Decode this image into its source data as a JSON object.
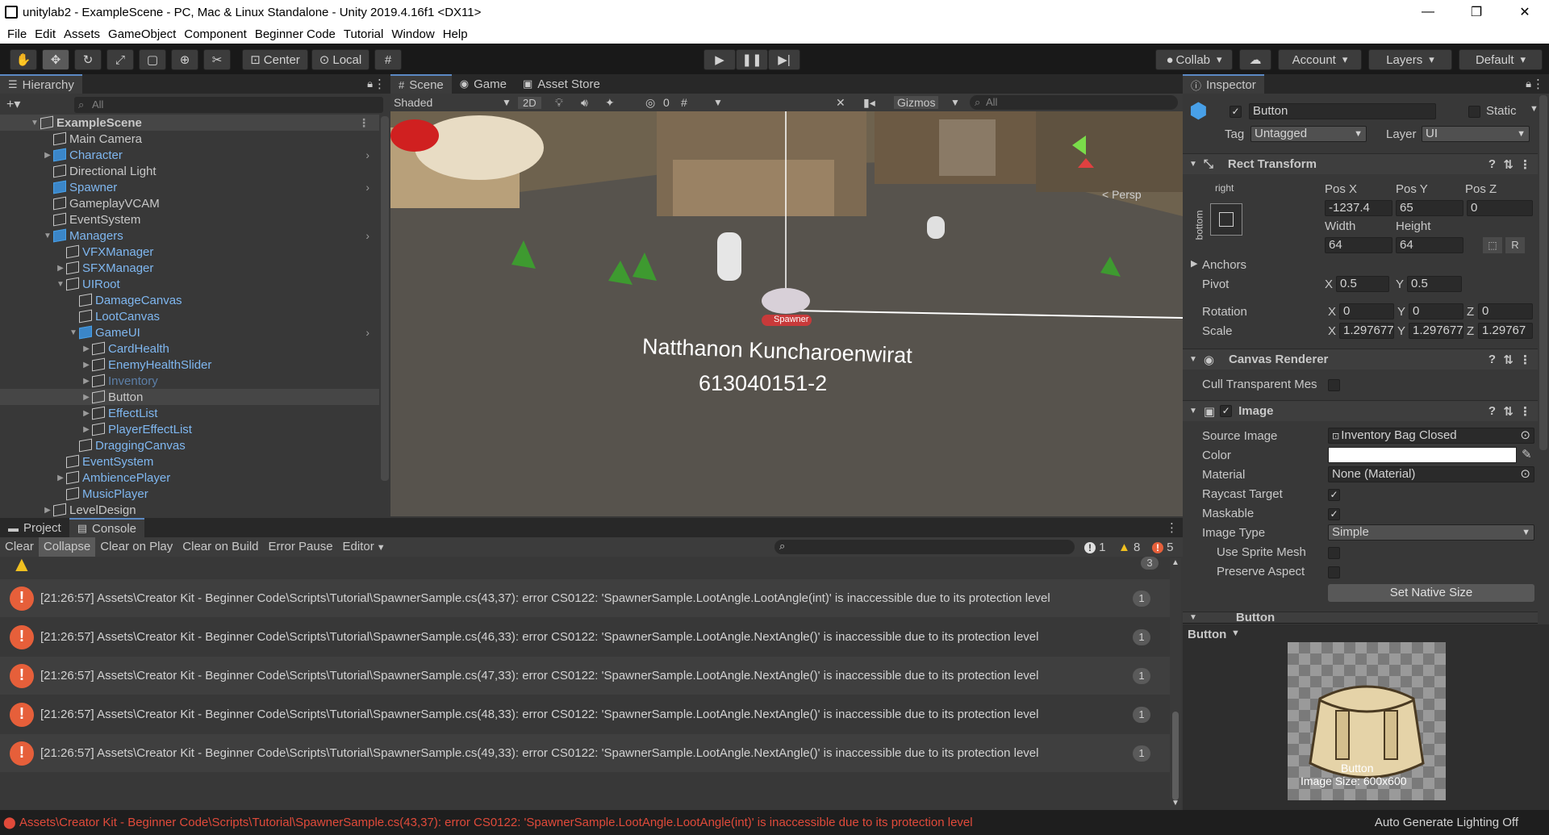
{
  "window": {
    "title": "unitylab2 - ExampleScene - PC, Mac & Linux Standalone - Unity 2019.4.16f1 <DX11>",
    "controls": [
      "—",
      "❐",
      "✕"
    ]
  },
  "menu": [
    "File",
    "Edit",
    "Assets",
    "GameObject",
    "Component",
    "Beginner Code",
    "Tutorial",
    "Window",
    "Help"
  ],
  "toolbar": {
    "pivot_label": "Center",
    "space_label": "Local",
    "collab_label": "Collab",
    "account_label": "Account",
    "layers_label": "Layers",
    "layout_label": "Default"
  },
  "hierarchy": {
    "tab_label": "Hierarchy",
    "search_placeholder": "All",
    "items": [
      {
        "label": "ExampleScene",
        "indent": 0,
        "arrow": "▼",
        "type": "scene"
      },
      {
        "label": "Main Camera",
        "indent": 1,
        "arrow": "",
        "type": "plain"
      },
      {
        "label": "Character",
        "indent": 1,
        "arrow": "▶",
        "type": "prefab",
        "more": true
      },
      {
        "label": "Directional Light",
        "indent": 1,
        "arrow": "",
        "type": "plain"
      },
      {
        "label": "Spawner",
        "indent": 1,
        "arrow": "",
        "type": "prefab",
        "more": true
      },
      {
        "label": "GameplayVCAM",
        "indent": 1,
        "arrow": "",
        "type": "plain"
      },
      {
        "label": "EventSystem",
        "indent": 1,
        "arrow": "",
        "type": "plain"
      },
      {
        "label": "Managers",
        "indent": 1,
        "arrow": "▼",
        "type": "prefab",
        "more": true
      },
      {
        "label": "VFXManager",
        "indent": 2,
        "arrow": "",
        "type": "prefab-child"
      },
      {
        "label": "SFXManager",
        "indent": 2,
        "arrow": "▶",
        "type": "prefab-child"
      },
      {
        "label": "UIRoot",
        "indent": 2,
        "arrow": "▼",
        "type": "prefab-child"
      },
      {
        "label": "DamageCanvas",
        "indent": 3,
        "arrow": "",
        "type": "prefab-child"
      },
      {
        "label": "LootCanvas",
        "indent": 3,
        "arrow": "",
        "type": "prefab-child"
      },
      {
        "label": "GameUI",
        "indent": 3,
        "arrow": "▼",
        "type": "prefab",
        "more": true
      },
      {
        "label": "CardHealth",
        "indent": 4,
        "arrow": "▶",
        "type": "prefab-child"
      },
      {
        "label": "EnemyHealthSlider",
        "indent": 4,
        "arrow": "▶",
        "type": "prefab-child"
      },
      {
        "label": "Inventory",
        "indent": 4,
        "arrow": "▶",
        "type": "dim"
      },
      {
        "label": "Button",
        "indent": 4,
        "arrow": "▶",
        "type": "selected"
      },
      {
        "label": "EffectList",
        "indent": 4,
        "arrow": "▶",
        "type": "prefab-child"
      },
      {
        "label": "PlayerEffectList",
        "indent": 4,
        "arrow": "▶",
        "type": "prefab-child"
      },
      {
        "label": "DraggingCanvas",
        "indent": 3,
        "arrow": "",
        "type": "prefab-child"
      },
      {
        "label": "EventSystem",
        "indent": 2,
        "arrow": "",
        "type": "prefab-child"
      },
      {
        "label": "AmbiencePlayer",
        "indent": 2,
        "arrow": "▶",
        "type": "prefab-child"
      },
      {
        "label": "MusicPlayer",
        "indent": 2,
        "arrow": "",
        "type": "prefab-child"
      },
      {
        "label": "LevelDesign",
        "indent": 1,
        "arrow": "▶",
        "type": "plain"
      }
    ]
  },
  "scene": {
    "tabs": [
      "Scene",
      "Game",
      "Asset Store"
    ],
    "shading_mode": "Shaded",
    "mode_2d": "2D",
    "hidden_count": "0",
    "gizmos_label": "Gizmos",
    "search_placeholder": "All",
    "perspective_label": "< Persp",
    "spawner_label": "Spawner",
    "overlay_name": "Natthanon Kuncharoenwirat",
    "overlay_id": "613040151-2"
  },
  "inspector": {
    "tab_label": "Inspector",
    "object_name": "Button",
    "static_label": "Static",
    "tag_label": "Tag",
    "tag_value": "Untagged",
    "layer_label": "Layer",
    "layer_value": "UI",
    "rect_transform": {
      "title": "Rect Transform",
      "anchor_h": "right",
      "anchor_v": "bottom",
      "pos_x_label": "Pos X",
      "pos_x": "-1237.4",
      "pos_y_label": "Pos Y",
      "pos_y": "65",
      "pos_z_label": "Pos Z",
      "pos_z": "0",
      "width_label": "Width",
      "width": "64",
      "height_label": "Height",
      "height": "64",
      "anchors_label": "Anchors",
      "pivot_label": "Pivot",
      "pivot_x": "0.5",
      "pivot_y": "0.5",
      "rotation_label": "Rotation",
      "rot_x": "0",
      "rot_y": "0",
      "rot_z": "0",
      "scale_label": "Scale",
      "scale_x": "1.297677",
      "scale_y": "1.297677",
      "scale_z": "1.29767",
      "r_button": "R"
    },
    "canvas_renderer": {
      "title": "Canvas Renderer",
      "cull_label": "Cull Transparent Mes"
    },
    "image": {
      "title": "Image",
      "source_image_label": "Source Image",
      "source_image_value": "Inventory Bag Closed",
      "color_label": "Color",
      "color_value": "#ffffff",
      "material_label": "Material",
      "material_value": "None (Material)",
      "raycast_label": "Raycast Target",
      "maskable_label": "Maskable",
      "image_type_label": "Image Type",
      "image_type_value": "Simple",
      "sprite_mesh_label": "Use Sprite Mesh",
      "preserve_label": "Preserve Aspect",
      "native_size_button": "Set Native Size"
    },
    "button_component": {
      "title": "Button"
    },
    "preview": {
      "dropdown": "Button",
      "caption_name": "Button",
      "caption_size": "Image Size: 600x600"
    }
  },
  "console": {
    "tabs": [
      "Project",
      "Console"
    ],
    "buttons": [
      "Clear",
      "Collapse",
      "Clear on Play",
      "Clear on Build",
      "Error Pause",
      "Editor"
    ],
    "info_count": "1",
    "warn_count": "8",
    "error_count": "5",
    "partial_count": "3",
    "logs": [
      {
        "text": "[21:26:57] Assets\\Creator Kit - Beginner Code\\Scripts\\Tutorial\\SpawnerSample.cs(43,37): error CS0122: 'SpawnerSample.LootAngle.LootAngle(int)' is inaccessible due to its protection level",
        "count": "1"
      },
      {
        "text": "[21:26:57] Assets\\Creator Kit - Beginner Code\\Scripts\\Tutorial\\SpawnerSample.cs(46,33): error CS0122: 'SpawnerSample.LootAngle.NextAngle()' is inaccessible due to its protection level",
        "count": "1"
      },
      {
        "text": "[21:26:57] Assets\\Creator Kit - Beginner Code\\Scripts\\Tutorial\\SpawnerSample.cs(47,33): error CS0122: 'SpawnerSample.LootAngle.NextAngle()' is inaccessible due to its protection level",
        "count": "1"
      },
      {
        "text": "[21:26:57] Assets\\Creator Kit - Beginner Code\\Scripts\\Tutorial\\SpawnerSample.cs(48,33): error CS0122: 'SpawnerSample.LootAngle.NextAngle()' is inaccessible due to its protection level",
        "count": "1"
      },
      {
        "text": "[21:26:57] Assets\\Creator Kit - Beginner Code\\Scripts\\Tutorial\\SpawnerSample.cs(49,33): error CS0122: 'SpawnerSample.LootAngle.NextAngle()' is inaccessible due to its protection level",
        "count": "1"
      }
    ]
  },
  "status": {
    "error_text": "Assets\\Creator Kit - Beginner Code\\Scripts\\Tutorial\\SpawnerSample.cs(43,37): error CS0122: 'SpawnerSample.LootAngle.LootAngle(int)' is inaccessible due to its protection level",
    "lighting": "Auto Generate Lighting Off"
  },
  "colors": {
    "error": "#e65f3a",
    "accent": "#5b89c4",
    "prefab": "#7fb7f0"
  }
}
